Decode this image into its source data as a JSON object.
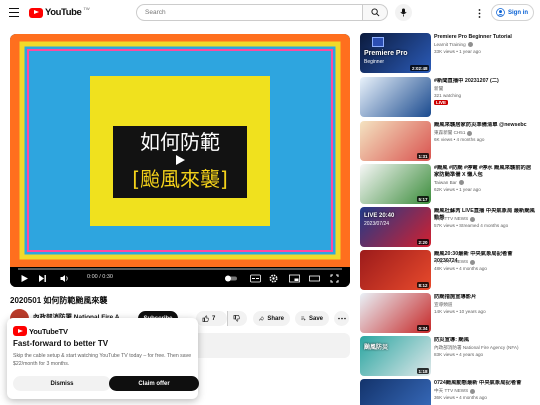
{
  "header": {
    "logo_text": "YouTube",
    "logo_cc": "TW",
    "search_placeholder": "Search",
    "signin_label": "Sign in"
  },
  "player": {
    "frame_title_line1": "如何防範",
    "frame_title_line2": "[颱風來襲]",
    "time": "0:00 / 0:30",
    "progress_fraction": 0.0,
    "colors": {
      "stripe_outer": "#ff6f1e",
      "stripe_mid": "#f0da2a",
      "stripe_inner": "#2ea5df",
      "panel": "#f0e11e",
      "label_bg": "#121212"
    }
  },
  "video": {
    "title": "2020501 如何防範颱風來襲",
    "channel_name": "內政部消防署 National Fire Agency (...",
    "subscribers": "",
    "subscribe_label": "Subscribe",
    "like_count": "7",
    "share_label": "Share",
    "save_label": "Save"
  },
  "promo": {
    "logo_text": "YouTubeTV",
    "heading": "Fast-forward to better TV",
    "body": "Skip the cable setup & start watching YouTube TV today – for free. Then save $22/month for 3 months.",
    "dismiss_label": "Dismiss",
    "claim_label": "Claim offer"
  },
  "recommendations": [
    {
      "title": "Premiere Pro Beginner Tutorial",
      "channel": "Learnit Training",
      "verified": true,
      "meta": "33K views • 1 year ago",
      "duration": "2:02:48",
      "live": false,
      "thumb_colors": [
        "#0b1a3c",
        "#2b5bb8"
      ],
      "thumb_text": "Premiere Pro",
      "thumb_subtext": "Beginner"
    },
    {
      "title": "#新聞直播中 20231207 (二)",
      "channel": "新聞",
      "verified": false,
      "meta": "321 watching",
      "duration": "",
      "live": true,
      "live_label": "LIVE",
      "thumb_colors": [
        "#e9f2fb",
        "#1a4a8e"
      ],
      "thumb_text": "",
      "thumb_subtext": ""
    },
    {
      "title": "颱風來襲居家防災準備清單 @newsebc",
      "channel": "東森新聞 CH51",
      "verified": true,
      "meta": "6K views • 4 months ago",
      "duration": "1:31",
      "live": false,
      "thumb_colors": [
        "#f4e3c1",
        "#d9534f"
      ],
      "thumb_text": "",
      "thumb_subtext": ""
    },
    {
      "title": "#颱風 #防颱 #停電 #停水 颱風來襲前的居家防颱準備 X 懶人包",
      "channel": "Taiwan Bar",
      "verified": true,
      "meta": "62K views • 1 year ago",
      "duration": "5:17",
      "live": false,
      "thumb_colors": [
        "#f7f7f7",
        "#3c8d3c"
      ],
      "thumb_text": "",
      "thumb_subtext": ""
    },
    {
      "title": "颱風杜蘇芮 LIVE直播 中央氣象局 最新颱風動態",
      "channel": "中天 TTV NEWS",
      "verified": true,
      "meta": "57K views • Streamed 4 months ago",
      "duration": "2:20",
      "live": false,
      "thumb_colors": [
        "#1f3b8a",
        "#d3202f"
      ],
      "thumb_text": "LIVE 20:40",
      "thumb_subtext": "2023/07/24"
    },
    {
      "title": "颱風20:30最新 中央氣象局記者會 20230724",
      "channel": "中天 TTV NEWS",
      "verified": true,
      "meta": "48K views • 4 months ago",
      "duration": "8:12",
      "live": false,
      "thumb_colors": [
        "#9c1b1b",
        "#e84a2c"
      ],
      "thumb_text": "",
      "thumb_subtext": ""
    },
    {
      "title": "防颱措施宣導影片",
      "channel": "宣導頻道",
      "verified": false,
      "meta": "14K views • 10 years ago",
      "duration": "0:34",
      "live": false,
      "thumb_colors": [
        "#e9f1f7",
        "#c62828"
      ],
      "thumb_text": "",
      "thumb_subtext": ""
    },
    {
      "title": "防災宣導: 颱風",
      "channel": "內政部消防署 National Fire Agency (NFA)",
      "verified": false,
      "meta": "83K views • 4 years ago",
      "duration": "1:18",
      "live": false,
      "thumb_colors": [
        "#2aa5a0",
        "#dfe8ea"
      ],
      "thumb_text": "颱風防災",
      "thumb_subtext": ""
    },
    {
      "title": "0724颱風動態最新 中央氣象局記者會",
      "channel": "中天 TTV NEWS",
      "verified": true,
      "meta": "36K views • 4 months ago",
      "duration": "",
      "live": false,
      "thumb_colors": [
        "#13336b",
        "#3a6ec0"
      ],
      "thumb_text": "",
      "thumb_subtext": ""
    }
  ]
}
